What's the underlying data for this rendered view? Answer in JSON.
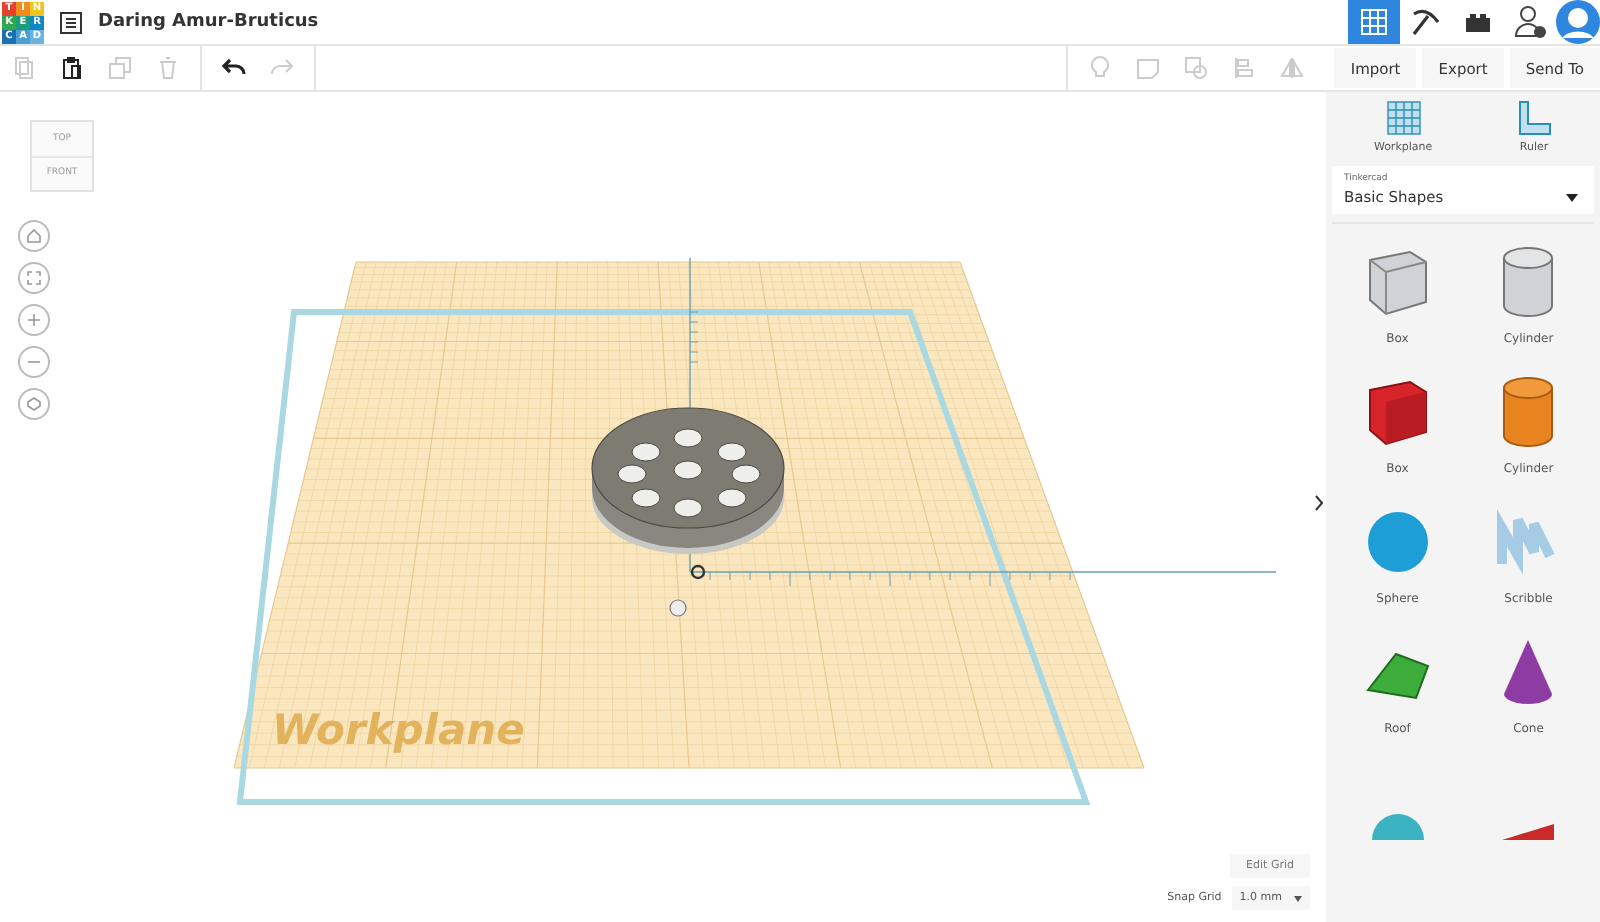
{
  "logo": {
    "rows": [
      [
        "T",
        "I",
        "N"
      ],
      [
        "K",
        "E",
        "R"
      ],
      [
        "C",
        "A",
        "D"
      ]
    ]
  },
  "title": "Daring Amur-Bruticus",
  "views": [
    {
      "kind": "grid",
      "selected": true
    },
    {
      "kind": "pickaxe",
      "selected": false
    },
    {
      "kind": "bricks",
      "selected": false
    }
  ],
  "edit_tools": [
    {
      "kind": "copy",
      "disabled": true
    },
    {
      "kind": "paste",
      "disabled": false
    },
    {
      "kind": "duplicate",
      "disabled": true
    },
    {
      "kind": "delete",
      "disabled": true
    },
    {
      "kind": "undo",
      "disabled": false
    },
    {
      "kind": "redo",
      "disabled": true
    }
  ],
  "shape_tools": [
    {
      "kind": "bulb",
      "disabled": true
    },
    {
      "kind": "note",
      "disabled": true
    },
    {
      "kind": "group",
      "disabled": true
    },
    {
      "kind": "align",
      "disabled": true
    },
    {
      "kind": "mirror",
      "disabled": true
    }
  ],
  "actions": [
    "Import",
    "Export",
    "Send To"
  ],
  "view_cube": {
    "top": "TOP",
    "front": "FRONT"
  },
  "nav": [
    {
      "kind": "home"
    },
    {
      "kind": "fit"
    },
    {
      "kind": "zoom-in"
    },
    {
      "kind": "zoom-out"
    },
    {
      "kind": "perspective"
    }
  ],
  "workplane_label": "Workplane",
  "grid": {
    "edit": "Edit Grid",
    "snap_label": "Snap Grid",
    "snap_value": "1.0 mm"
  },
  "helpers": [
    {
      "kind": "workplane",
      "label": "Workplane"
    },
    {
      "kind": "ruler",
      "label": "Ruler"
    }
  ],
  "library": {
    "source": "Tinkercad",
    "category": "Basic Shapes"
  },
  "shapes": [
    {
      "kind": "box-hole",
      "label": "Box"
    },
    {
      "kind": "cylinder-hole",
      "label": "Cylinder"
    },
    {
      "kind": "box",
      "label": "Box"
    },
    {
      "kind": "cylinder",
      "label": "Cylinder"
    },
    {
      "kind": "sphere",
      "label": "Sphere"
    },
    {
      "kind": "scribble",
      "label": "Scribble"
    },
    {
      "kind": "roof",
      "label": "Roof"
    },
    {
      "kind": "cone",
      "label": "Cone"
    },
    {
      "kind": "dome"
    },
    {
      "kind": "wedge"
    }
  ]
}
